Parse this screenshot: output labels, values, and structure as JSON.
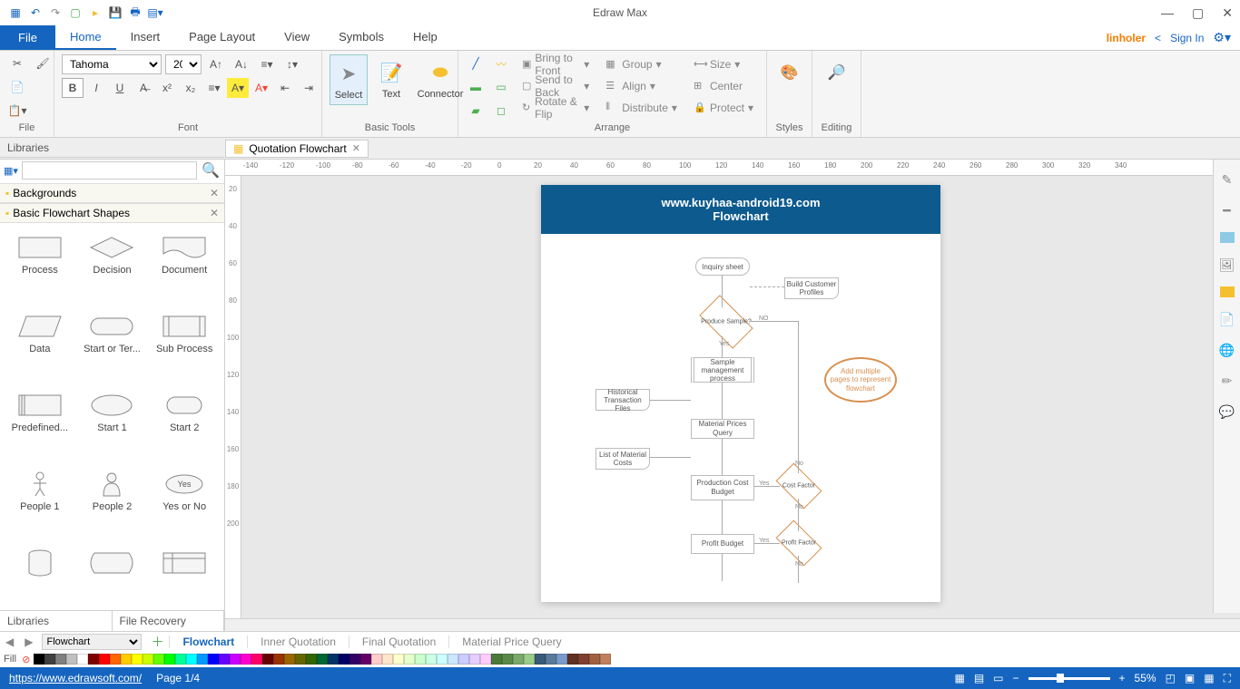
{
  "app_title": "Edraw Max",
  "menus": {
    "file": "File",
    "tabs": [
      "Home",
      "Insert",
      "Page Layout",
      "View",
      "Symbols",
      "Help"
    ],
    "active": 0,
    "linholer": "linholer",
    "signin": "Sign In"
  },
  "ribbon": {
    "file_grp": "File",
    "font_grp": "Font",
    "tools_grp": "Basic Tools",
    "arrange_grp": "Arrange",
    "font_name": "Tahoma",
    "font_size": "20",
    "select": "Select",
    "text": "Text",
    "connector": "Connector",
    "bring_front": "Bring to Front",
    "send_back": "Send to Back",
    "rotate": "Rotate & Flip",
    "group": "Group",
    "align": "Align",
    "distribute": "Distribute",
    "size": "Size",
    "center": "Center",
    "protect": "Protect",
    "styles": "Styles",
    "editing": "Editing"
  },
  "doctab": {
    "name": "Quotation Flowchart"
  },
  "libraries": {
    "title": "Libraries",
    "cat1": "Backgrounds",
    "cat2": "Basic Flowchart Shapes",
    "tabs": [
      "Libraries",
      "File Recovery"
    ],
    "shapes": [
      "Process",
      "Decision",
      "Document",
      "Data",
      "Start or Ter...",
      "Sub Process",
      "Predefined...",
      "Start 1",
      "Start 2",
      "People 1",
      "People 2",
      "Yes or No"
    ]
  },
  "ruler_h": [
    "-140",
    "-120",
    "-100",
    "-80",
    "-60",
    "-40",
    "-20",
    "0",
    "20",
    "40",
    "60",
    "80",
    "100",
    "120",
    "140",
    "160",
    "180",
    "200",
    "220",
    "240",
    "260",
    "280",
    "300",
    "320",
    "340"
  ],
  "ruler_v": [
    "20",
    "40",
    "60",
    "80",
    "100",
    "120",
    "140",
    "160",
    "180",
    "200"
  ],
  "page": {
    "hdr1": "www.kuyhaa-android19.com",
    "hdr2": "Flowchart",
    "inquiry": "Inquiry sheet",
    "build_cust": "Build Customer Profiles",
    "produce_q": "Produce Sample?",
    "yes": "Yes",
    "no": "NO",
    "sample_mgmt": "Sample management process",
    "hist": "Historical Transaction Files",
    "mat_price": "Material Prices Query",
    "list_mat": "List of Material Costs",
    "prod_cost": "Production Cost Budget",
    "cost_factor": "Cost Factor",
    "profit_budget": "Profit Budget",
    "profit_factor": "Profit Factor",
    "callout": "Add multiple pages to represent flowchart"
  },
  "pagetabs": {
    "sel": "Flowchart",
    "tabs": [
      "Flowchart",
      "Inner Quotation",
      "Final Quotation",
      "Material Price Query"
    ]
  },
  "colorbar_label": "Fill",
  "colors": [
    "#000000",
    "#404040",
    "#808080",
    "#c0c0c0",
    "#ffffff",
    "#800000",
    "#ff0000",
    "#ff6600",
    "#ffcc00",
    "#ffff00",
    "#ccff00",
    "#66ff00",
    "#00ff00",
    "#00ff99",
    "#00ffff",
    "#0099ff",
    "#0000ff",
    "#6600ff",
    "#cc00ff",
    "#ff00cc",
    "#ff0066",
    "#660000",
    "#993300",
    "#996600",
    "#666600",
    "#336600",
    "#006633",
    "#003366",
    "#000066",
    "#330066",
    "#660066",
    "#ffcccc",
    "#ffe6cc",
    "#ffffcc",
    "#e6ffcc",
    "#ccffcc",
    "#ccffe6",
    "#ccffff",
    "#cce6ff",
    "#ccccff",
    "#e6ccff",
    "#ffccff",
    "#4a7a3a",
    "#5a8a4a",
    "#7aaa6a",
    "#9acc8a",
    "#3a5a7a",
    "#5a7a9a",
    "#7a9acc",
    "#603020",
    "#804030",
    "#a06040",
    "#c08060"
  ],
  "status": {
    "link": "https://www.edrawsoft.com/",
    "page": "Page 1/4",
    "zoom": "55%"
  }
}
